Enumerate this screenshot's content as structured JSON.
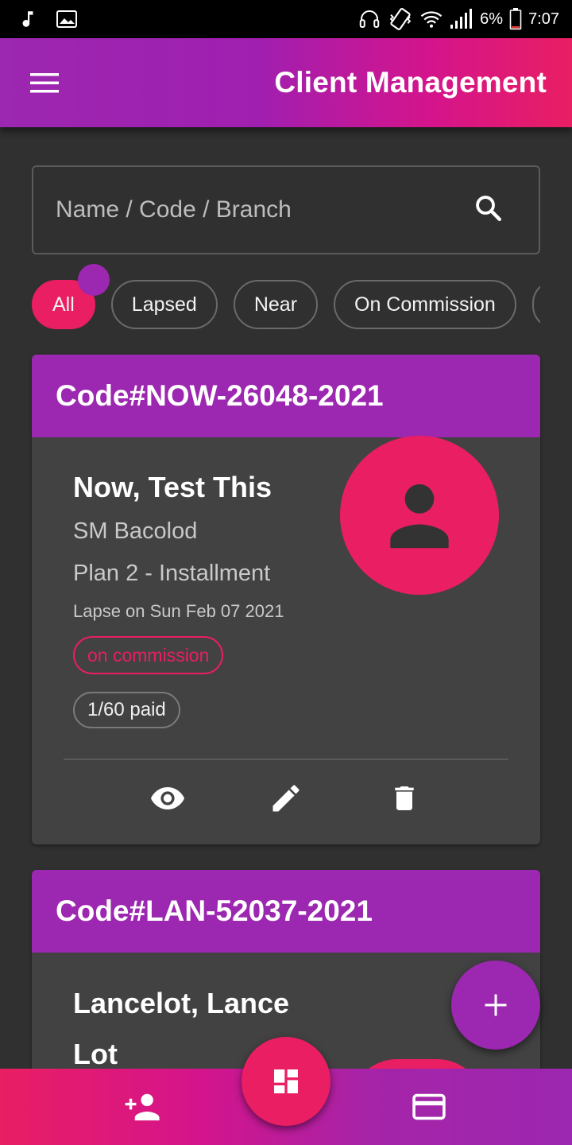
{
  "status_bar": {
    "battery": "6%",
    "time": "7:07",
    "icons": [
      "music-note-icon",
      "image-icon",
      "headphones-icon",
      "vibrate-icon",
      "wifi-icon",
      "signal-icon",
      "battery-icon"
    ]
  },
  "app_bar": {
    "title": "Client Management",
    "menu_icon": "menu-icon"
  },
  "search": {
    "placeholder": "Name / Code / Branch",
    "icon": "search-icon"
  },
  "filters": {
    "chips": [
      {
        "label": "All",
        "active": true
      },
      {
        "label": "Lapsed",
        "active": false
      },
      {
        "label": "Near",
        "active": false
      },
      {
        "label": "On Commission",
        "active": false
      }
    ]
  },
  "clients": [
    {
      "code": "Code#NOW-26048-2021",
      "name": "Now, Test This",
      "branch": "SM Bacolod",
      "plan": "Plan 2 - Installment",
      "lapse": "Lapse on Sun Feb 07 2021",
      "status": "on commission",
      "paid": "1/60 paid"
    },
    {
      "code": "Code#LAN-52037-2021",
      "name": "Lancelot, Lance",
      "name_line2": "Lot"
    }
  ],
  "colors": {
    "primary": "#9c27b0",
    "accent": "#e91e63",
    "background": "#303030",
    "card": "#424242"
  }
}
